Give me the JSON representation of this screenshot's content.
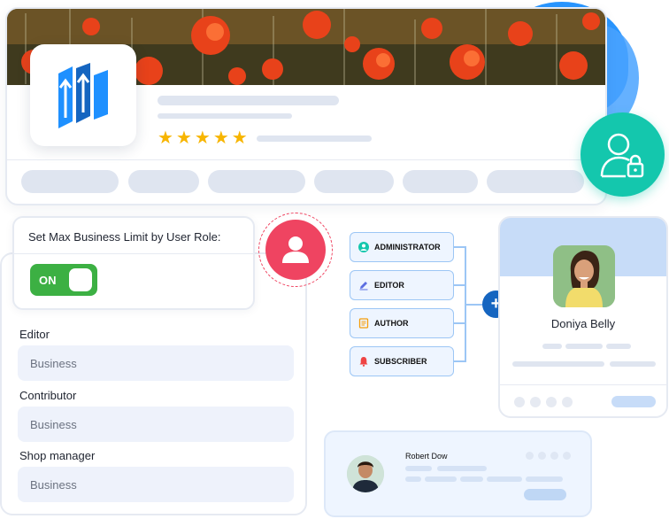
{
  "settings": {
    "title": "Set Max Business Limit by User Role:",
    "toggle_label": "ON",
    "fields": [
      {
        "label": "Editor",
        "placeholder": "Business"
      },
      {
        "label": "Contributor",
        "placeholder": "Business"
      },
      {
        "label": "Shop manager",
        "placeholder": "Business"
      }
    ]
  },
  "rating": {
    "stars": 5,
    "star_glyph": "★",
    "color": "#f7b500"
  },
  "roles": [
    {
      "label": "ADMINISTRATOR",
      "icon": "user-circle-icon",
      "color": "#14c7ad"
    },
    {
      "label": "EDITOR",
      "icon": "pencil-icon",
      "color": "#5b6ee1"
    },
    {
      "label": "AUTHOR",
      "icon": "document-icon",
      "color": "#f59e0b"
    },
    {
      "label": "SUBSCRIBER",
      "icon": "bell-icon",
      "color": "#ef4444"
    }
  ],
  "add_button": {
    "label": "+"
  },
  "profile": {
    "name": "Doniya Belly"
  },
  "bottom_user": {
    "name": "Robert Dow"
  },
  "colors": {
    "accent_blue": "#1565c0",
    "toggle_green": "#3cb043",
    "lock_teal": "#14c7ad",
    "user_red": "#ef4461"
  }
}
